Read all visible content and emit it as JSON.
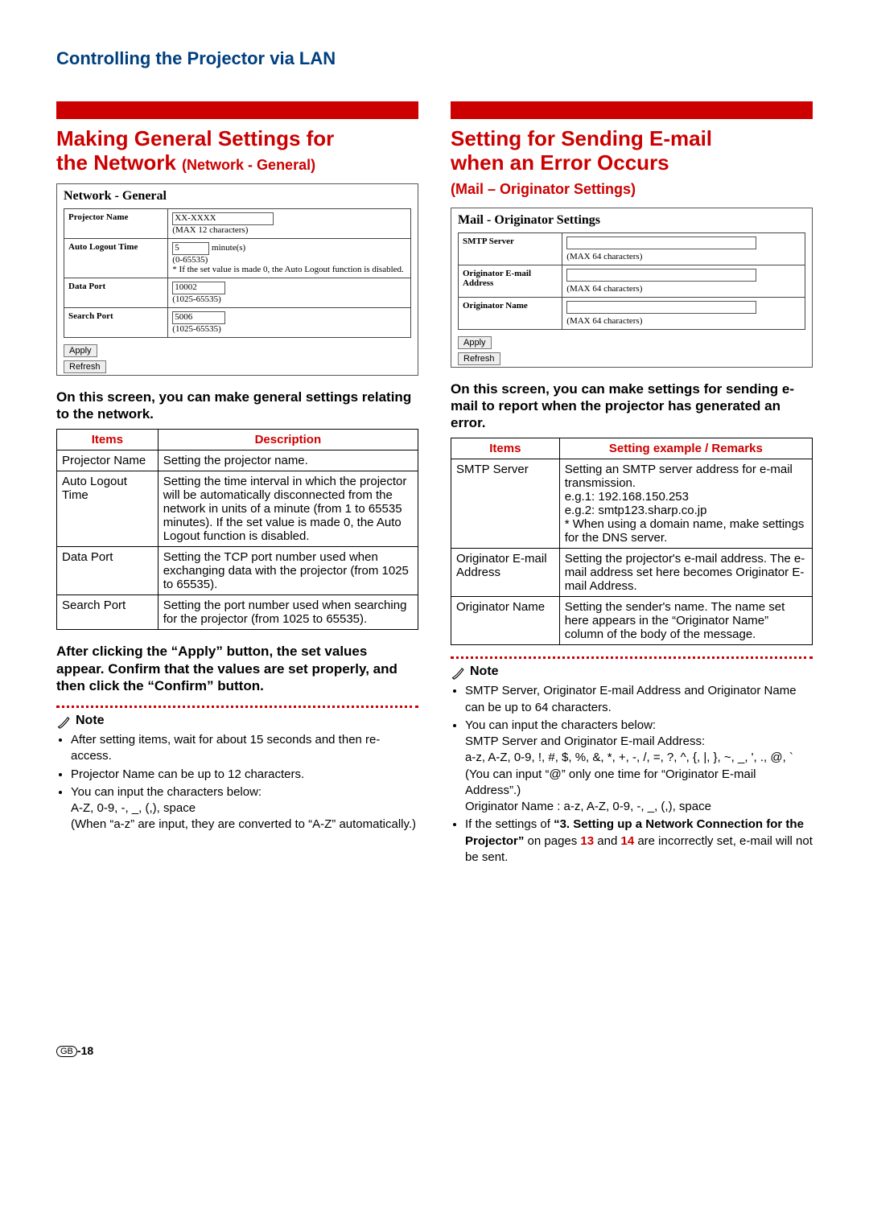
{
  "page": {
    "title": "Controlling the Projector via LAN",
    "footer_lang": "GB",
    "footer_page": "-18"
  },
  "left": {
    "heading_line1": "Making General Settings for",
    "heading_line2": "the Network",
    "heading_sub": " (Network - General)",
    "screenshot": {
      "title": "Network - General",
      "rows": {
        "projector_name": {
          "label": "Projector Name",
          "value": "XX-XXXX",
          "hint": "(MAX 12 characters)"
        },
        "auto_logout": {
          "label": "Auto Logout Time",
          "value": "5",
          "unit": "minute(s)",
          "hint1": "(0-65535)",
          "hint2": "* If the set value is made 0, the Auto Logout function is disabled."
        },
        "data_port": {
          "label": "Data Port",
          "value": "10002",
          "hint": "(1025-65535)"
        },
        "search_port": {
          "label": "Search Port",
          "value": "5006",
          "hint": "(1025-65535)"
        }
      },
      "btn_apply": "Apply",
      "btn_refresh": "Refresh"
    },
    "intro": "On this screen, you can make general settings relating to the network.",
    "table": {
      "h1": "Items",
      "h2": "Description",
      "r1c1": "Projector Name",
      "r1c2": "Setting the projector name.",
      "r2c1": "Auto Logout Time",
      "r2c2": "Setting the time interval in which the projector will be automatically disconnected from the network in units of a minute (from 1 to 65535 minutes). If the set value is made 0, the Auto Logout function is disabled.",
      "r3c1": "Data Port",
      "r3c2": "Setting the TCP port number used when exchanging data with the projector (from 1025 to 65535).",
      "r4c1": "Search Port",
      "r4c2": "Setting the port number used when searching for the projector (from 1025 to 65535)."
    },
    "after_apply": "After clicking the “Apply” button, the set values appear. Confirm that the values are set properly, and then click the “Confirm” button.",
    "note_label": "Note",
    "notes": {
      "n1": "After setting items, wait for about 15 seconds and then re-access.",
      "n2": "Projector Name can be up to 12 characters.",
      "n3a": "You can input the characters below:",
      "n3b": "A-Z, 0-9, -, _, (,), space",
      "n3c": "(When “a-z” are input, they are converted to “A-Z” automatically.)"
    }
  },
  "right": {
    "heading_line1": "Setting for Sending E-mail",
    "heading_line2": "when an Error Occurs",
    "heading_sub": "(Mail – Originator Settings)",
    "screenshot": {
      "title": "Mail - Originator Settings",
      "rows": {
        "smtp": {
          "label": "SMTP Server",
          "hint": "(MAX 64 characters)"
        },
        "addr": {
          "label": "Originator E-mail Address",
          "hint": "(MAX 64 characters)"
        },
        "name": {
          "label": "Originator Name",
          "hint": "(MAX 64 characters)"
        }
      },
      "btn_apply": "Apply",
      "btn_refresh": "Refresh"
    },
    "intro": "On this screen, you can make settings for sending e-mail to report when the projector has generated an error.",
    "table": {
      "h1": "Items",
      "h2": "Setting example / Remarks",
      "r1c1": "SMTP Server",
      "r1c2": "Setting an SMTP server address for e-mail transmission.\ne.g.1: 192.168.150.253\ne.g.2: smtp123.sharp.co.jp\n* When using a domain name, make settings for the DNS server.",
      "r2c1": "Originator E-mail Address",
      "r2c2": "Setting the projector's e-mail address. The e-mail address set here becomes Originator E-mail Address.",
      "r3c1": "Originator Name",
      "r3c2": "Setting the sender's name.  The name set here appears in the “Originator Name” column of the body of the message."
    },
    "note_label": "Note",
    "notes": {
      "n1": "SMTP Server, Originator E-mail Address and Originator Name can be up to 64 characters.",
      "n2a": "You can input the characters below:",
      "n2b": "SMTP Server and Originator E-mail Address:",
      "n2c": "a-z, A-Z, 0-9, !, #, $, %, &, *, +, -, /, =, ?, ^, {, |, }, ~, _, ', ., @, `",
      "n2d": "(You can input “@” only one time for “Originator E-mail Address”.)",
      "n2e": "Originator Name : a-z, A-Z, 0-9, -, _, (,), space",
      "n3a": "If the settings of ",
      "n3b": "“3. Setting up a Network Connection for the Projector”",
      "n3c": " on pages ",
      "n3d": "13",
      "n3e": " and ",
      "n3f": "14",
      "n3g": " are incorrectly set, e-mail will not be sent."
    }
  }
}
